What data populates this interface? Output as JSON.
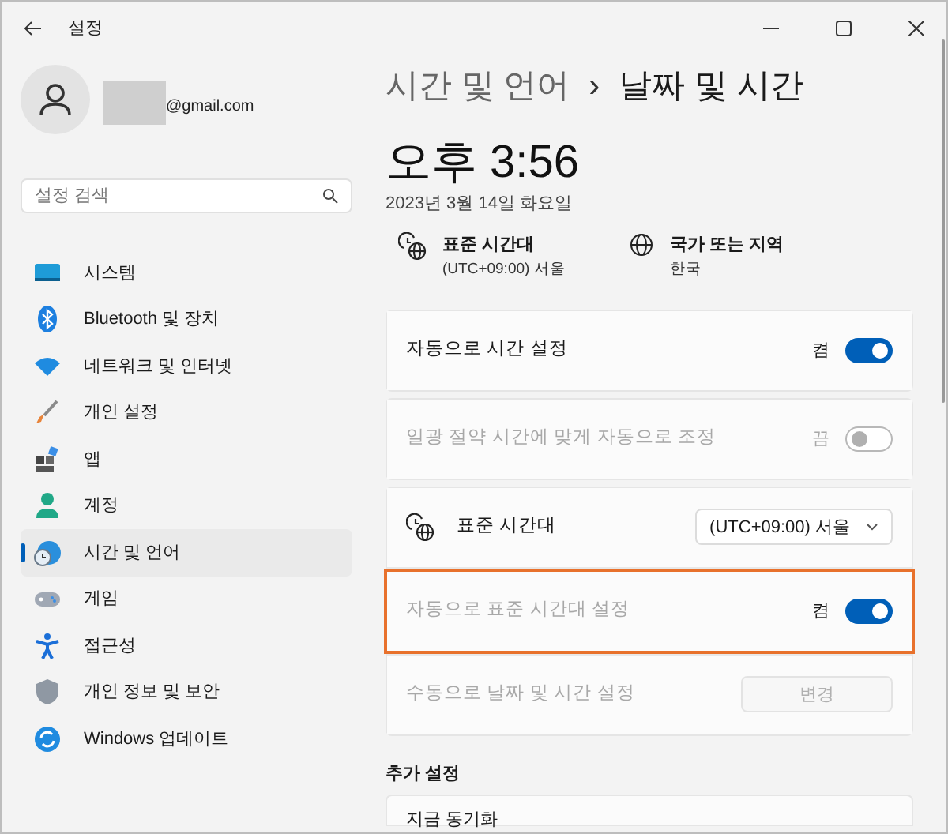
{
  "window": {
    "title": "설정"
  },
  "account": {
    "email": "@gmail.com"
  },
  "search": {
    "placeholder": "설정 검색"
  },
  "sidebar": {
    "items": [
      {
        "label": "시스템",
        "selected": false
      },
      {
        "label": "Bluetooth 및 장치",
        "selected": false
      },
      {
        "label": "네트워크 및 인터넷",
        "selected": false
      },
      {
        "label": "개인 설정",
        "selected": false
      },
      {
        "label": "앱",
        "selected": false
      },
      {
        "label": "계정",
        "selected": false
      },
      {
        "label": "시간 및 언어",
        "selected": true
      },
      {
        "label": "게임",
        "selected": false
      },
      {
        "label": "접근성",
        "selected": false
      },
      {
        "label": "개인 정보 및 보안",
        "selected": false
      },
      {
        "label": "Windows 업데이트",
        "selected": false
      }
    ]
  },
  "breadcrumb": {
    "parent": "시간 및 언어",
    "separator": "›",
    "current": "날짜 및 시간"
  },
  "clock": {
    "time": "오후 3:56",
    "date": "2023년 3월 14일 화요일"
  },
  "info": [
    {
      "title": "표준 시간대",
      "value": "(UTC+09:00) 서울"
    },
    {
      "title": "국가 또는 지역",
      "value": "한국"
    }
  ],
  "groups": [
    [
      {
        "kind": "toggle",
        "label": "자동으로 시간 설정",
        "state": "켬",
        "on": true,
        "disabled": false,
        "highlighted": false
      }
    ],
    [
      {
        "kind": "toggle",
        "label": "일광 절약 시간에 맞게 자동으로 조정",
        "state": "끔",
        "on": false,
        "disabled": true,
        "highlighted": false
      }
    ],
    [
      {
        "kind": "dropdown",
        "label": "표준 시간대",
        "value": "(UTC+09:00) 서울",
        "disabled": false,
        "highlighted": false
      },
      {
        "kind": "toggle",
        "label": "자동으로 표준 시간대 설정",
        "state": "켬",
        "on": true,
        "disabled": true,
        "highlighted": true
      },
      {
        "kind": "button",
        "label": "수동으로 날짜 및 시간 설정",
        "button": "변경",
        "disabled": true,
        "highlighted": false
      }
    ]
  ],
  "more": {
    "heading": "추가 설정",
    "rows": [
      {
        "label": "지금 동기화"
      }
    ]
  }
}
